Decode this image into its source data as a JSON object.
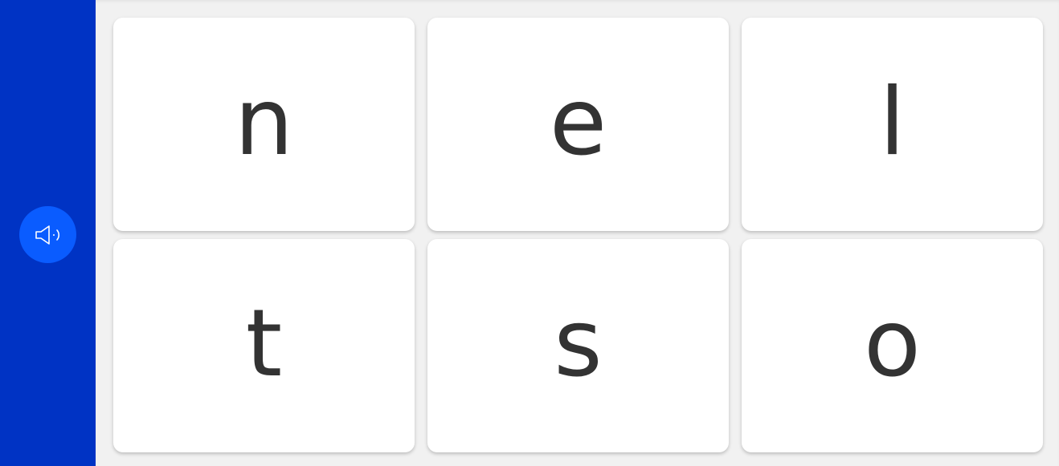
{
  "sidebar": {
    "audio_icon": "speaker-sound-icon",
    "background_color": "#0033c4",
    "button_color": "#0a5cff"
  },
  "tiles": [
    {
      "letter": "n"
    },
    {
      "letter": "e"
    },
    {
      "letter": "l"
    },
    {
      "letter": "t"
    },
    {
      "letter": "s"
    },
    {
      "letter": "o"
    }
  ]
}
